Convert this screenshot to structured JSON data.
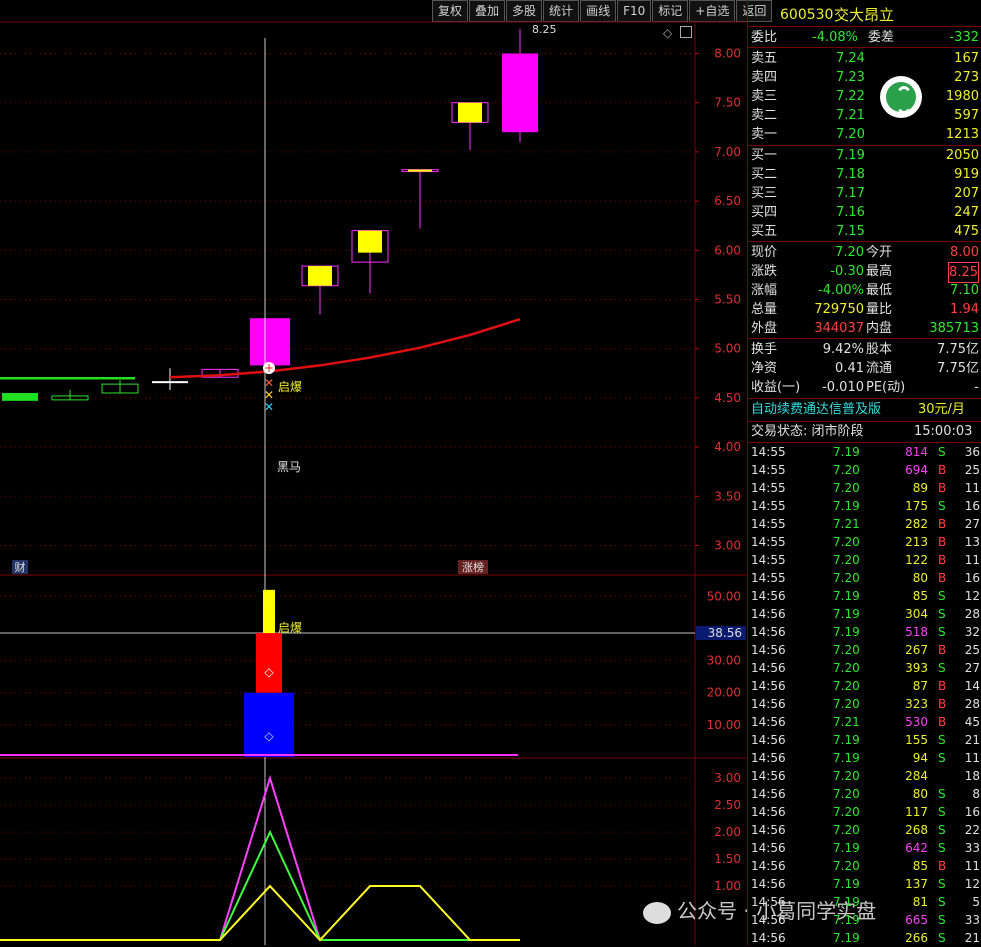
{
  "toolbar": [
    "复权",
    "叠加",
    "多股",
    "统计",
    "画线",
    "F10",
    "标记",
    "+自选",
    "返回"
  ],
  "stock": {
    "code": "600530",
    "name": "交大昂立"
  },
  "weibi": {
    "label": "委比",
    "value": "-4.08%",
    "diff_label": "委差",
    "diff": "-332"
  },
  "asks": [
    {
      "label": "卖五",
      "price": "7.24",
      "vol": "167"
    },
    {
      "label": "卖四",
      "price": "7.23",
      "vol": "273"
    },
    {
      "label": "卖三",
      "price": "7.22",
      "vol": "1980"
    },
    {
      "label": "卖二",
      "price": "7.21",
      "vol": "597"
    },
    {
      "label": "卖一",
      "price": "7.20",
      "vol": "1213"
    }
  ],
  "bids": [
    {
      "label": "买一",
      "price": "7.19",
      "vol": "2050"
    },
    {
      "label": "买二",
      "price": "7.18",
      "vol": "919"
    },
    {
      "label": "买三",
      "price": "7.17",
      "vol": "207"
    },
    {
      "label": "买四",
      "price": "7.16",
      "vol": "247"
    },
    {
      "label": "买五",
      "price": "7.15",
      "vol": "475"
    }
  ],
  "quote": [
    {
      "l1": "现价",
      "v1": "7.20",
      "c1": "g",
      "l2": "今开",
      "v2": "8.00",
      "c2": "r"
    },
    {
      "l1": "涨跌",
      "v1": "-0.30",
      "c1": "g",
      "l2": "最高",
      "v2": "8.25",
      "c2": "r"
    },
    {
      "l1": "涨幅",
      "v1": "-4.00%",
      "c1": "g",
      "l2": "最低",
      "v2": "7.10",
      "c2": "g"
    },
    {
      "l1": "总量",
      "v1": "729750",
      "c1": "y",
      "l2": "量比",
      "v2": "1.94",
      "c2": "r"
    },
    {
      "l1": "外盘",
      "v1": "344037",
      "c1": "r",
      "l2": "内盘",
      "v2": "385713",
      "c2": "g"
    }
  ],
  "fund": [
    {
      "l1": "换手",
      "v1": "9.42%",
      "l2": "股本",
      "v2": "7.75亿"
    },
    {
      "l1": "净资",
      "v1": "0.41",
      "l2": "流通",
      "v2": "7.75亿"
    },
    {
      "l1": "收益(一)",
      "v1": "-0.010",
      "l2": "PE(动)",
      "v2": "-"
    }
  ],
  "subscription": {
    "text": "自动续费通达信普及版",
    "price": "30元/月"
  },
  "trade_status": {
    "label": "交易状态: 闭市阶段",
    "time": "15:00:03"
  },
  "ticks": [
    [
      "14:55",
      "7.19",
      "814",
      "S",
      "36"
    ],
    [
      "14:55",
      "7.20",
      "694",
      "B",
      "25"
    ],
    [
      "14:55",
      "7.20",
      "89",
      "B",
      "11"
    ],
    [
      "14:55",
      "7.19",
      "175",
      "S",
      "16"
    ],
    [
      "14:55",
      "7.21",
      "282",
      "B",
      "27"
    ],
    [
      "14:55",
      "7.20",
      "213",
      "B",
      "13"
    ],
    [
      "14:55",
      "7.20",
      "122",
      "B",
      "11"
    ],
    [
      "14:55",
      "7.20",
      "80",
      "B",
      "16"
    ],
    [
      "14:56",
      "7.19",
      "85",
      "S",
      "12"
    ],
    [
      "14:56",
      "7.19",
      "304",
      "S",
      "28"
    ],
    [
      "14:56",
      "7.19",
      "518",
      "S",
      "32"
    ],
    [
      "14:56",
      "7.20",
      "267",
      "B",
      "25"
    ],
    [
      "14:56",
      "7.20",
      "393",
      "S",
      "27"
    ],
    [
      "14:56",
      "7.20",
      "87",
      "B",
      "14"
    ],
    [
      "14:56",
      "7.20",
      "323",
      "B",
      "28"
    ],
    [
      "14:56",
      "7.21",
      "530",
      "B",
      "45"
    ],
    [
      "14:56",
      "7.19",
      "155",
      "S",
      "21"
    ],
    [
      "14:56",
      "7.19",
      "94",
      "S",
      "11"
    ],
    [
      "14:56",
      "7.20",
      "284",
      "",
      "18"
    ],
    [
      "14:56",
      "7.20",
      "80",
      "S",
      "8"
    ],
    [
      "14:56",
      "7.20",
      "117",
      "S",
      "16"
    ],
    [
      "14:56",
      "7.20",
      "268",
      "S",
      "22"
    ],
    [
      "14:56",
      "7.19",
      "642",
      "S",
      "33"
    ],
    [
      "14:56",
      "7.20",
      "85",
      "B",
      "11"
    ],
    [
      "14:56",
      "7.19",
      "137",
      "S",
      "12"
    ],
    [
      "14:56",
      "7.19",
      "81",
      "S",
      "5"
    ],
    [
      "14:56",
      "7.19",
      "665",
      "S",
      "33"
    ],
    [
      "14:56",
      "7.19",
      "266",
      "S",
      "21"
    ]
  ],
  "chart_labels": {
    "qibao": "启爆",
    "heima": "黑马",
    "cai": "财",
    "zhangbang": "涨榜",
    "high_marker": "8.25",
    "cross_value": "38.56"
  },
  "watermark": "公众号 · 小葛同学实盘",
  "chart_data": [
    {
      "type": "candlestick",
      "ylim": [
        2.7,
        8.3
      ],
      "yticks": [
        "8.00",
        "7.50",
        "7.00",
        "6.50",
        "6.00",
        "5.50",
        "5.00",
        "4.50",
        "4.00",
        "3.50",
        "3.00"
      ],
      "ytick_values": [
        8.0,
        7.5,
        7.0,
        6.5,
        6.0,
        5.5,
        5.0,
        4.5,
        4.0,
        3.5,
        3.0
      ],
      "candles": [
        {
          "o": 4.55,
          "c": 4.47,
          "h": 4.55,
          "l": 4.47
        },
        {
          "o": 4.48,
          "c": 4.52,
          "h": 4.58,
          "l": 4.48
        },
        {
          "o": 4.55,
          "c": 4.64,
          "h": 4.68,
          "l": 4.55
        },
        {
          "o": 4.66,
          "c": 4.66,
          "h": 4.8,
          "l": 4.58
        },
        {
          "o": 4.71,
          "c": 4.79,
          "h": 4.79,
          "l": 4.71
        },
        {
          "o": 4.83,
          "c": 5.31,
          "h": 5.31,
          "l": 4.83
        },
        {
          "o": 5.84,
          "c": 5.64,
          "h": 5.84,
          "l": 5.35
        },
        {
          "o": 6.2,
          "c": 5.88,
          "h": 6.2,
          "l": 5.56
        },
        {
          "o": 6.82,
          "c": 6.8,
          "h": 6.82,
          "l": 6.22
        },
        {
          "o": 7.5,
          "c": 7.3,
          "h": 7.5,
          "l": 7.02
        },
        {
          "o": 8.0,
          "c": 7.2,
          "h": 8.25,
          "l": 7.1
        }
      ],
      "ma": [
        4.68,
        4.69,
        4.7,
        4.71,
        4.73,
        4.77,
        4.83,
        4.91,
        5.01,
        5.14,
        5.3
      ],
      "ma_prefix": [
        4.7,
        4.7,
        4.7,
        4.7
      ]
    },
    {
      "type": "bar",
      "ylim": [
        0,
        56
      ],
      "yticks": [
        "50.00",
        "30.00",
        "20.00",
        "10.00"
      ],
      "ytick_values": [
        50,
        30,
        20,
        10
      ],
      "bars": [
        {
          "from": 0,
          "to": 20,
          "color": "#0000ff"
        },
        {
          "from": 20,
          "to": 38.56,
          "color": "#ff0000"
        },
        {
          "from": 38.56,
          "to": 52,
          "color": "#ffff00"
        }
      ]
    },
    {
      "type": "line",
      "ylim": [
        0,
        3.3
      ],
      "yticks": [
        "3.00",
        "2.50",
        "2.00",
        "1.50",
        "1.00"
      ],
      "ytick_values": [
        3.0,
        2.5,
        2.0,
        1.5,
        1.0
      ],
      "series": [
        {
          "color": "#ff40ff",
          "values": [
            0,
            0,
            0,
            0,
            0,
            3,
            0,
            0,
            0,
            0,
            0
          ]
        },
        {
          "color": "#40ff40",
          "values": [
            0,
            0,
            0,
            0,
            0,
            2,
            0,
            0,
            0,
            0,
            0
          ]
        },
        {
          "color": "#ffff20",
          "values": [
            0,
            0,
            0,
            0,
            0,
            1,
            0,
            1,
            1,
            0,
            0
          ]
        }
      ]
    }
  ]
}
